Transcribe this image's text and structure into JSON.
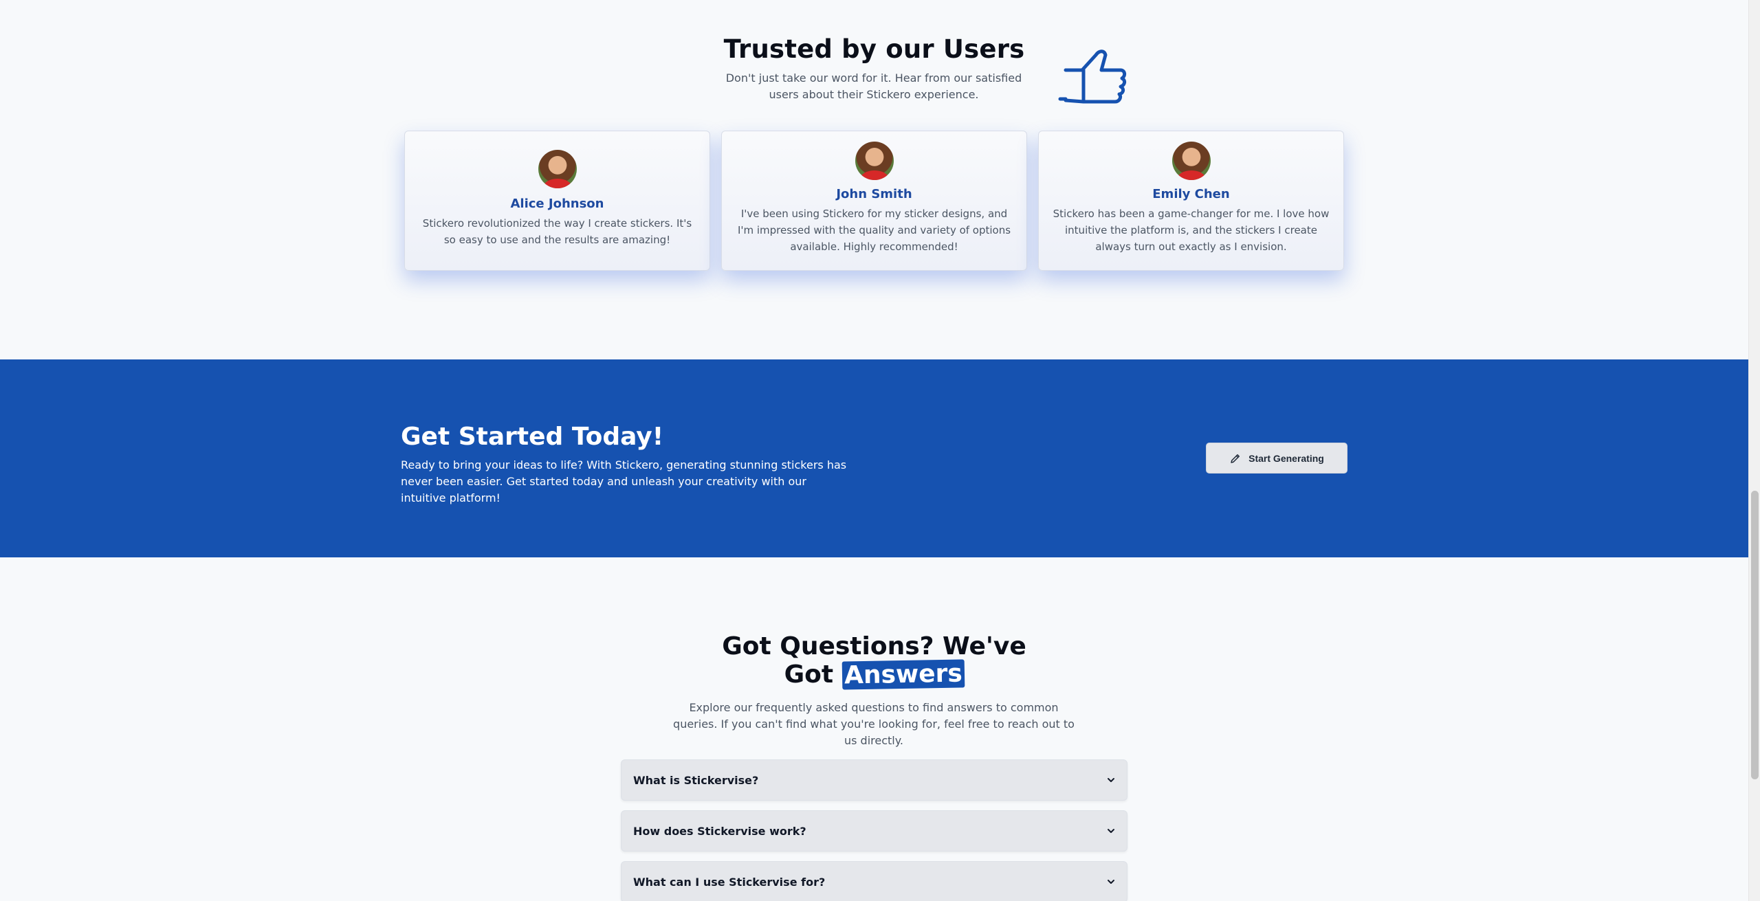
{
  "testimonials": {
    "title": "Trusted by our Users",
    "subtitle": "Don't just take our word for it. Hear from our satisfied users about their Stickero experience.",
    "cards": [
      {
        "name": "Alice Johnson",
        "quote": "Stickero revolutionized the way I create stickers. It's so easy to use and the results are amazing!"
      },
      {
        "name": "John Smith",
        "quote": "I've been using Stickero for my sticker designs, and I'm impressed with the quality and variety of options available. Highly recommended!"
      },
      {
        "name": "Emily Chen",
        "quote": "Stickero has been a game-changer for me. I love how intuitive the platform is, and the stickers I create always turn out exactly as I envision."
      }
    ]
  },
  "cta": {
    "title": "Get Started Today!",
    "text": "Ready to bring your ideas to life? With Stickero, generating stunning stickers has never been easier. Get started today and unleash your creativity with our intuitive platform!",
    "button_label": "Start Generating"
  },
  "faq": {
    "title_line1": "Got Questions? We've",
    "title_line2_prefix": "Got",
    "title_highlight": "Answers",
    "subtitle": "Explore our frequently asked questions to find answers to common queries. If you can't find what you're looking for, feel free to reach out to us directly.",
    "items": [
      {
        "question": "What is Stickervise?"
      },
      {
        "question": "How does Stickervise work?"
      },
      {
        "question": "What can I use Stickervise for?"
      }
    ]
  },
  "colors": {
    "brand_blue": "#1652b0",
    "name_blue": "#1e4aa0",
    "background": "#f7f9fb"
  }
}
